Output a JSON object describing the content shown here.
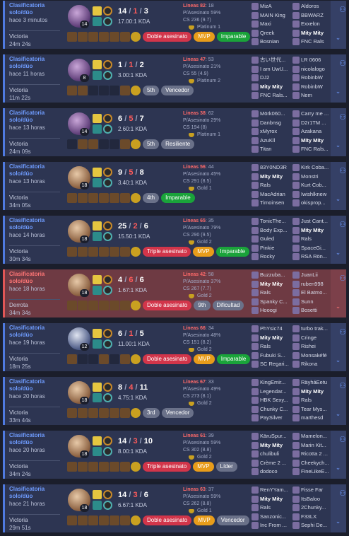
{
  "matches": [
    {
      "queue": "Clasificatoria solo/dúo",
      "ago": "hace 3 minutos",
      "result": "Victoria",
      "duration": "24m 24s",
      "win": true,
      "champ_style": "c1",
      "level": "14",
      "kills": "14",
      "deaths": "1",
      "assists": "3",
      "ratio": "17.00:1 KDA",
      "items": [
        "i",
        "i",
        "i",
        "i",
        "i",
        "i",
        "t"
      ],
      "badges": [
        {
          "label": "Doble asesinato",
          "color": "red"
        },
        {
          "label": "MVP",
          "color": "gold"
        },
        {
          "label": "Imparable",
          "color": "green"
        }
      ],
      "lineas": "Líneas 82",
      "lineas_num": ": 18",
      "p_asesinato": "P/Asesinato 59%",
      "cs": "CS 236 (9.7)",
      "tier": "Platinum 1",
      "team_blue": [
        "MizA",
        "MAIN King",
        "Maxi",
        "Qreek",
        "Bosnian"
      ],
      "team_red": [
        "Aldoros",
        "BBWARZ",
        "Exxelon",
        "Mity Mity",
        "FNC Rals"
      ],
      "me_blue": -1,
      "me_red": 3
    },
    {
      "queue": "Clasificatoria solo/dúo",
      "ago": "hace 11 horas",
      "result": "Victoria",
      "duration": "11m 22s",
      "win": true,
      "champ_style": "c1",
      "level": "8",
      "kills": "1",
      "deaths": "1",
      "assists": "2",
      "ratio": "3.00:1 KDA",
      "items": [
        "i",
        "i",
        "e",
        "e",
        "e",
        "i",
        "t"
      ],
      "badges": [
        {
          "label": "5th",
          "color": "grey"
        },
        {
          "label": "Vencedor",
          "color": "grey"
        }
      ],
      "lineas": "Líneas 47",
      "lineas_num": ": 53",
      "p_asesinato": "P/Asesinato 21%",
      "cs": "CS 55 (4.9)",
      "tier": "Platinum 2",
      "team_blue": [
        "古い世代...",
        "I am UwU...",
        "DJ2",
        "Mity Mity",
        "FNC Rals..."
      ],
      "team_red": [
        "LR 0606",
        "nicolalogo",
        "RobinbW",
        "RobinbW",
        "Nem"
      ],
      "me_blue": 3,
      "me_red": -1
    },
    {
      "queue": "Clasificatoria solo/dúo",
      "ago": "hace 13 horas",
      "result": "Victoria",
      "duration": "24m 09s",
      "win": true,
      "champ_style": "c1",
      "level": "14",
      "kills": "6",
      "deaths": "5",
      "assists": "7",
      "ratio": "2.60:1 KDA",
      "items": [
        "e",
        "i",
        "i",
        "e",
        "e",
        "i",
        "t"
      ],
      "badges": [
        {
          "label": "5th",
          "color": "grey"
        },
        {
          "label": "Resiliente",
          "color": "grey"
        }
      ],
      "lineas": "Líneas 38",
      "lineas_num": ": 62",
      "p_asesinato": "P/Asesinato 29%",
      "cs": "CS 194 (8)",
      "tier": "Platinum 1",
      "team_blue": [
        "Mörk060...",
        "Danbnsg",
        "xMyrox",
        "AzuKll",
        "Titan"
      ],
      "team_red": [
        "Carry me ...",
        "D2r1TM ...",
        "Azakana",
        "Mity Mity",
        "FNC Rals..."
      ],
      "me_blue": -1,
      "me_red": 3
    },
    {
      "queue": "Clasificatoria solo/dúo",
      "ago": "hace 13 horas",
      "result": "Victoria",
      "duration": "34m 05s",
      "win": true,
      "champ_style": "c2",
      "level": "18",
      "kills": "9",
      "deaths": "5",
      "assists": "8",
      "ratio": "3.40:1 KDA",
      "items": [
        "i",
        "i",
        "i",
        "i",
        "i",
        "i",
        "t"
      ],
      "badges": [
        {
          "label": "4th",
          "color": "grey"
        },
        {
          "label": "Imparable",
          "color": "green"
        }
      ],
      "lineas": "Líneas 56",
      "lineas_num": ": 44",
      "p_asesinato": "P/Asesinato 45%",
      "cs": "CS 291 (8.5)",
      "tier": "Gold 1",
      "team_blue": [
        "83Y0ND3R",
        "Mity Mity",
        "Rals",
        "MacAdrian",
        "Timoinsen"
      ],
      "team_red": [
        "Kirk Coba...",
        "Monstri",
        "Kurt Cob...",
        "Iwishlknew",
        "okisprop..."
      ],
      "me_blue": 1,
      "me_red": -1
    },
    {
      "queue": "Clasificatoria solo/dúo",
      "ago": "hace 14 horas",
      "result": "Victoria",
      "duration": "30m 34s",
      "win": true,
      "champ_style": "c2",
      "level": "18",
      "kills": "25",
      "deaths": "2",
      "assists": "6",
      "ratio": "15.50:1 KDA",
      "items": [
        "i",
        "i",
        "i",
        "i",
        "i",
        "i",
        "t"
      ],
      "badges": [
        {
          "label": "Triple asesinato",
          "color": "red"
        },
        {
          "label": "MVP",
          "color": "gold"
        },
        {
          "label": "Imparable",
          "color": "green"
        }
      ],
      "lineas": "Líneas 65",
      "lineas_num": ": 35",
      "p_asesinato": "P/Asesinato 79%",
      "cs": "CS 290 (9.5)",
      "tier": "Gold 2",
      "team_blue": [
        "TonicThe...",
        "Body Exp...",
        "Guled",
        "Pinkie",
        "Rocky"
      ],
      "team_red": [
        "Just Cant...",
        "Mity Mity",
        "Rals",
        "SpaceGi...",
        "RSA Rön..."
      ],
      "me_blue": -1,
      "me_red": 1
    },
    {
      "queue": "Clasificatoria solo/dúo",
      "ago": "hace 18 horas",
      "result": "Derrota",
      "duration": "34m 34s",
      "win": false,
      "champ_style": "c2",
      "level": "18",
      "kills": "4",
      "deaths": "6",
      "assists": "6",
      "ratio": "1.67:1 KDA",
      "items": [
        "i",
        "i",
        "i",
        "i",
        "i",
        "i",
        "t"
      ],
      "badges": [
        {
          "label": "Doble asesinato",
          "color": "red"
        },
        {
          "label": "9th",
          "color": "grey"
        },
        {
          "label": "Dificultad",
          "color": "grey"
        }
      ],
      "lineas": "Líneas 42",
      "lineas_num": ": 58",
      "p_asesinato": "P/Asesinato 37%",
      "cs": "CS 267 (7.7)",
      "tier": "Gold 2",
      "team_blue": [
        "Buzzuba...",
        "Mity Mity",
        "Rals",
        "Spanky C...",
        "Hooogi"
      ],
      "team_red": [
        "JuanLii",
        "ruben998",
        "El Batmo...",
        "Sunn",
        "Bosetti"
      ],
      "me_blue": 1,
      "me_red": -1
    },
    {
      "queue": "Clasificatoria solo/dúo",
      "ago": "hace 19 horas",
      "result": "Victoria",
      "duration": "18m 25s",
      "win": true,
      "champ_style": "c3",
      "level": "12",
      "kills": "6",
      "deaths": "1",
      "assists": "5",
      "ratio": "11.00:1 KDA",
      "items": [
        "i",
        "e",
        "e",
        "i",
        "e",
        "i",
        "t"
      ],
      "badges": [
        {
          "label": "Doble asesinato",
          "color": "red"
        },
        {
          "label": "MVP",
          "color": "gold"
        },
        {
          "label": "Imparable",
          "color": "green"
        }
      ],
      "lineas": "Líneas 66",
      "lineas_num": ": 34",
      "p_asesinato": "P/Asesinato 48%",
      "cs": "CS 151 (8.2)",
      "tier": "Gold 2",
      "team_blue": [
        "PhYsic74",
        "Mity Mity",
        "Rals",
        "Fubuki S...",
        "SC Regari..."
      ],
      "team_red": [
        "turbo trak...",
        "Cringe",
        "Rishei",
        "Monsakéfé",
        "Rikona"
      ],
      "me_blue": 1,
      "me_red": -1
    },
    {
      "queue": "Clasificatoria solo/dúo",
      "ago": "hace 20 horas",
      "result": "Victoria",
      "duration": "33m 44s",
      "win": true,
      "champ_style": "c2",
      "level": "18",
      "kills": "8",
      "deaths": "4",
      "assists": "11",
      "ratio": "4.75:1 KDA",
      "items": [
        "i",
        "i",
        "i",
        "i",
        "i",
        "i",
        "t"
      ],
      "badges": [
        {
          "label": "3rd",
          "color": "grey"
        },
        {
          "label": "Vencedor",
          "color": "grey"
        }
      ],
      "lineas": "Líneas 67",
      "lineas_num": ": 33",
      "p_asesinato": "P/Asesinato 49%",
      "cs": "CS 273 (8.1)",
      "tier": "Gold 2",
      "team_blue": [
        "KingEmir...",
        "Legendar...",
        "HBK Sexy...",
        "Chunky C...",
        "PaySilver"
      ],
      "team_red": [
        "RäyháEetu",
        "Mity Mity",
        "Rals",
        "Tear Mys...",
        "marthesd"
      ],
      "me_blue": -1,
      "me_red": 1
    },
    {
      "queue": "Clasificatoria solo/dúo",
      "ago": "hace 20 horas",
      "result": "Victoria",
      "duration": "34m 24s",
      "win": true,
      "champ_style": "c2",
      "level": "18",
      "kills": "14",
      "deaths": "3",
      "assists": "10",
      "ratio": "8.00:1 KDA",
      "items": [
        "i",
        "i",
        "i",
        "i",
        "i",
        "i",
        "t"
      ],
      "badges": [
        {
          "label": "Triple asesinato",
          "color": "red"
        },
        {
          "label": "MVP",
          "color": "gold"
        },
        {
          "label": "Líder",
          "color": "grey"
        }
      ],
      "lineas": "Líneas 61",
      "lineas_num": ": 39",
      "p_asesinato": "P/Asesinato 59%",
      "cs": "CS 302 (8.8)",
      "tier": "Gold 2",
      "team_blue": [
        "KäruSpur...",
        "Mity Mity",
        "chulibuli",
        "Crème 2 ...",
        "dodoco"
      ],
      "team_red": [
        "Mamelon...",
        "Marin Kit...",
        "Ricotta 2 ...",
        "Cheekych...",
        "FineLikeE..."
      ],
      "me_blue": 1,
      "me_red": -1
    },
    {
      "queue": "Clasificatoria solo/dúo",
      "ago": "hace 21 horas",
      "result": "Victoria",
      "duration": "29m 51s",
      "win": true,
      "champ_style": "c2",
      "level": "18",
      "kills": "14",
      "deaths": "3",
      "assists": "6",
      "ratio": "6.67:1 KDA",
      "items": [
        "i",
        "i",
        "i",
        "i",
        "i",
        "i",
        "t"
      ],
      "badges": [
        {
          "label": "Doble asesinato",
          "color": "red"
        },
        {
          "label": "MVP",
          "color": "gold"
        },
        {
          "label": "Vencedor",
          "color": "grey"
        }
      ],
      "lineas": "Líneas 63",
      "lineas_num": ": 37",
      "p_asesinato": "P/Asesinato 59%",
      "cs": "CS 262 (8.8)",
      "tier": "Gold 1",
      "team_blue": [
        "RenYYam...",
        "Mity Mity",
        "Rals",
        "Sanzonic...",
        "Inc From ..."
      ],
      "team_red": [
        "Fisse Far",
        "ItsBaloo",
        "2Chunky...",
        "F33LX",
        "Sephi De..."
      ],
      "me_blue": 1,
      "me_red": -1
    }
  ],
  "icons": {
    "add_player": "add-player-icon",
    "expand": "chevron-down-icon",
    "tier": "tier-emblem-icon"
  },
  "glyphs": {
    "add_player": "⚇",
    "expand": "⌄",
    "slash": "/"
  },
  "colors": {
    "win_bg": "#2d3552",
    "loss_bg": "#6e3a43",
    "win_accent": "#4f7ae0",
    "loss_accent": "#e05656"
  }
}
